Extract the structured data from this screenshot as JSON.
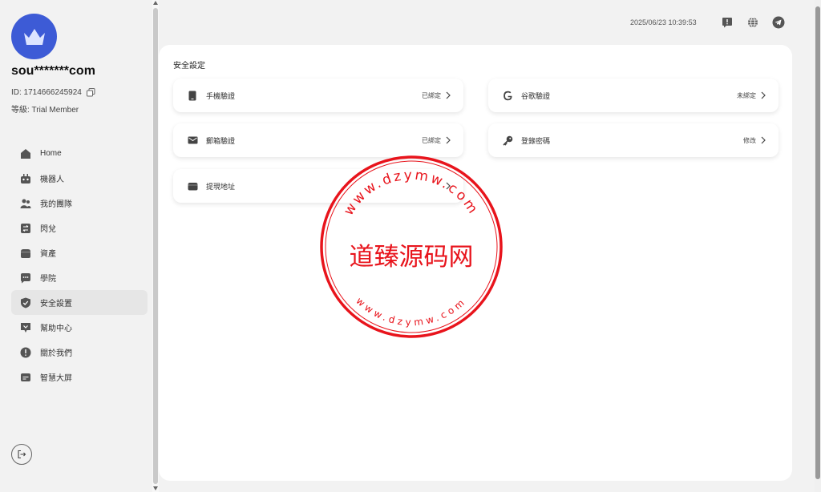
{
  "user": {
    "name": "sou*******com",
    "id_label": "ID: 1714666245924",
    "level_label": "等級: Trial Member"
  },
  "sidebar": {
    "items": [
      {
        "label": "Home",
        "icon": "home-icon"
      },
      {
        "label": "機器人",
        "icon": "robot-icon"
      },
      {
        "label": "我的團隊",
        "icon": "team-icon"
      },
      {
        "label": "閃兌",
        "icon": "exchange-icon"
      },
      {
        "label": "資產",
        "icon": "wallet-icon"
      },
      {
        "label": "學院",
        "icon": "chat-icon"
      },
      {
        "label": "安全設置",
        "icon": "shield-icon",
        "active": true
      },
      {
        "label": "幫助中心",
        "icon": "help-icon"
      },
      {
        "label": "關於我們",
        "icon": "info-icon"
      },
      {
        "label": "智慧大屏",
        "icon": "screen-icon"
      }
    ]
  },
  "header": {
    "datetime": "2025/06/23 10:39:53"
  },
  "panel": {
    "title": "安全設定",
    "cards": [
      {
        "label": "手機驗證",
        "status": "已綁定",
        "icon": "phone-icon"
      },
      {
        "label": "谷歌驗證",
        "status": "未綁定",
        "icon": "google-icon"
      },
      {
        "label": "郵箱驗證",
        "status": "已綁定",
        "icon": "mail-icon"
      },
      {
        "label": "登錄密碼",
        "status": "修改",
        "icon": "key-icon"
      },
      {
        "label": "提現地址",
        "status": "",
        "icon": "wallet-icon"
      }
    ]
  },
  "watermark": {
    "center_text": "道臻源码网",
    "top_arc": "www.dzymw.com",
    "bottom_arc": "www.dzymw.com"
  },
  "colors": {
    "accent": "#3d5bd6",
    "stamp": "#e8141c",
    "icon": "#444444"
  }
}
